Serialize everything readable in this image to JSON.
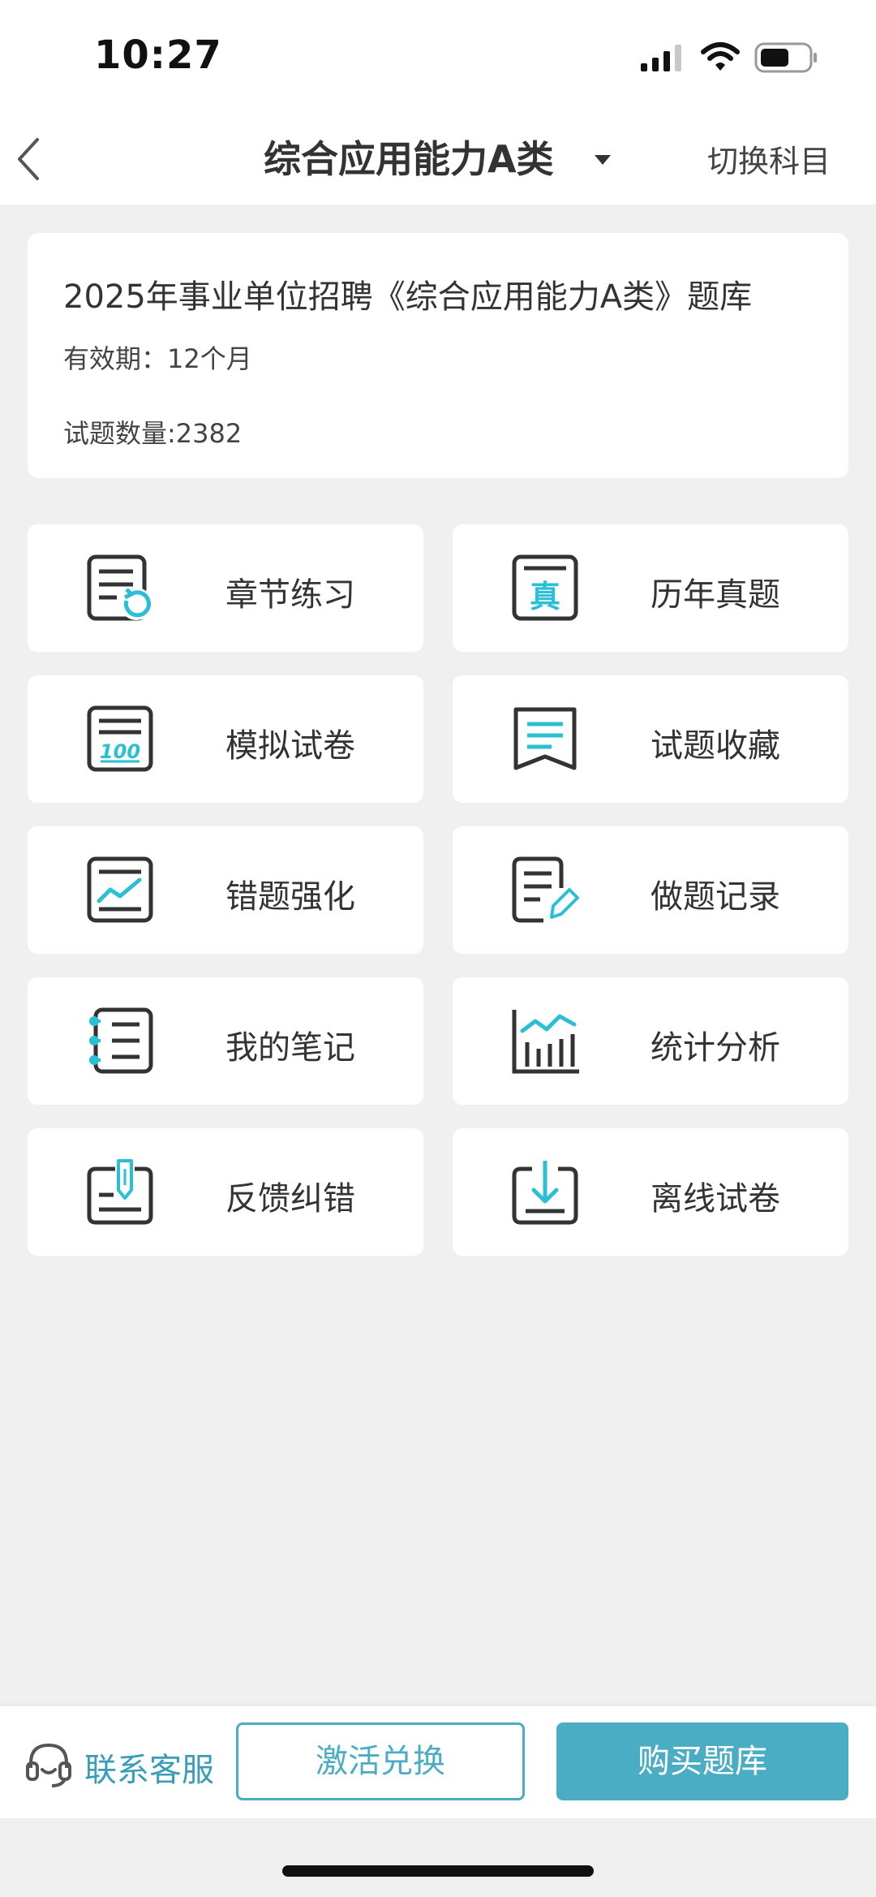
{
  "status_bar": {
    "time": "10:27",
    "icons": [
      "signal-icon",
      "wifi-icon",
      "battery-icon"
    ]
  },
  "nav": {
    "back_icon": "chevron-left-icon",
    "title": "综合应用能力A类",
    "dropdown_icon": "caret-down-icon",
    "switch_label": "切换科目"
  },
  "info": {
    "title": "2025年事业单位招聘《综合应用能力A类》题库",
    "validity": "有效期：12个月",
    "question_count": "试题数量:2382"
  },
  "menu": [
    {
      "label": "章节练习",
      "icon": "chapter-practice-icon"
    },
    {
      "label": "历年真题",
      "icon": "past-exams-icon"
    },
    {
      "label": "模拟试卷",
      "icon": "mock-paper-icon"
    },
    {
      "label": "试题收藏",
      "icon": "favorites-icon"
    },
    {
      "label": "错题强化",
      "icon": "wrong-questions-icon"
    },
    {
      "label": "做题记录",
      "icon": "practice-record-icon"
    },
    {
      "label": "我的笔记",
      "icon": "notes-icon"
    },
    {
      "label": "统计分析",
      "icon": "statistics-icon"
    },
    {
      "label": "反馈纠错",
      "icon": "feedback-icon"
    },
    {
      "label": "离线试卷",
      "icon": "offline-download-icon"
    }
  ],
  "bottom": {
    "contact_label": "联系客服",
    "contact_icon": "headset-icon",
    "activate_label": "激活兑换",
    "buy_label": "购买题库"
  },
  "colors": {
    "accent": "#4aadc3",
    "icon_accent": "#2bbfd6",
    "icon_dark": "#333333",
    "background": "#f0f0f0"
  }
}
